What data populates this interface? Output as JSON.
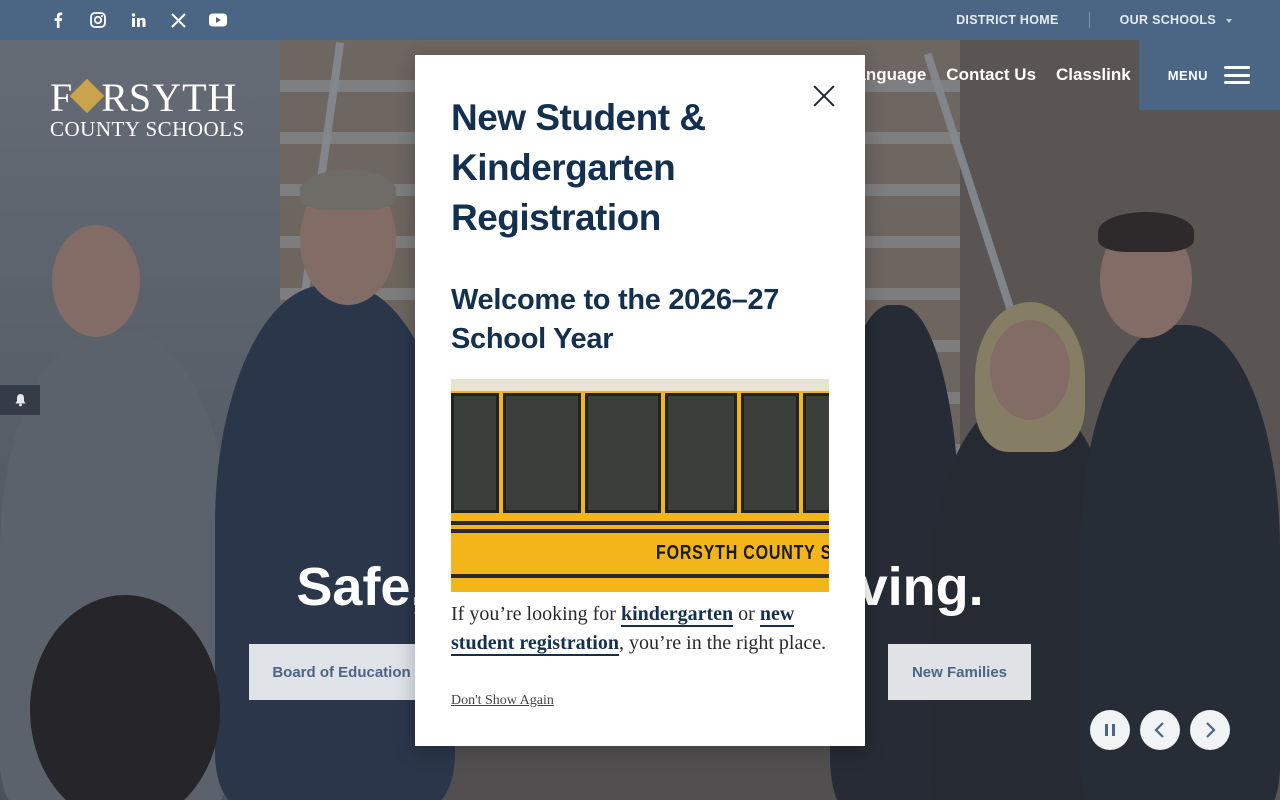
{
  "topbar": {
    "social_icons": [
      "facebook-icon",
      "instagram-icon",
      "linkedin-icon",
      "x-icon",
      "youtube-icon"
    ],
    "district_home": "DISTRICT HOME",
    "our_schools": "OUR SCHOOLS"
  },
  "logo": {
    "line1_a": "F",
    "line1_b": "RSYTH",
    "line2": "COUNTY SCHOOLS"
  },
  "nav": {
    "language": "Language",
    "contact": "Contact Us",
    "classlink": "Classlink",
    "menu": "MENU"
  },
  "hero": {
    "tagline": "Safe, Successful, Thriving.",
    "buttons": [
      "Board of Education",
      "New Families"
    ]
  },
  "modal": {
    "title": "New Student & Kindergarten Registration",
    "subtitle": "Welcome to the 2026–27 School Year",
    "image_text": "FORSYTH COUNTY SCHOOLS",
    "text_before": "If you’re looking for ",
    "link1": "kindergarten",
    "text_mid": " or ",
    "link2": "new student registration",
    "text_after": ", you’re in the right place.",
    "dont_show": "Don't Show Again"
  },
  "colors": {
    "topbar": "#4b6584",
    "heading": "#14304f",
    "bus_yellow": "#f2b51a"
  }
}
